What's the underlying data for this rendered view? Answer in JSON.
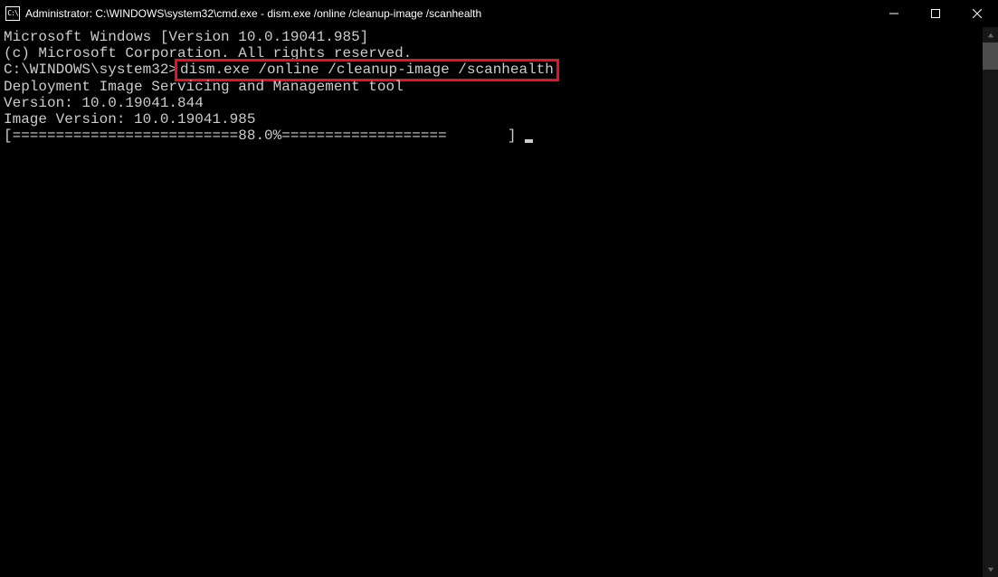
{
  "window": {
    "title": "Administrator: C:\\WINDOWS\\system32\\cmd.exe - dism.exe  /online /cleanup-image /scanhealth",
    "icon_label": "C:\\"
  },
  "terminal": {
    "line1": "Microsoft Windows [Version 10.0.19041.985]",
    "line2": "(c) Microsoft Corporation. All rights reserved.",
    "blank1": "",
    "prompt": "C:\\WINDOWS\\system32>",
    "command": "dism.exe /online /cleanup-image /scanhealth",
    "blank2": "",
    "tool_line1": "Deployment Image Servicing and Management tool",
    "tool_line2": "Version: 10.0.19041.844",
    "blank3": "",
    "image_version": "Image Version: 10.0.19041.985",
    "blank4": "",
    "progress": "[==========================88.0%===================       ] "
  }
}
